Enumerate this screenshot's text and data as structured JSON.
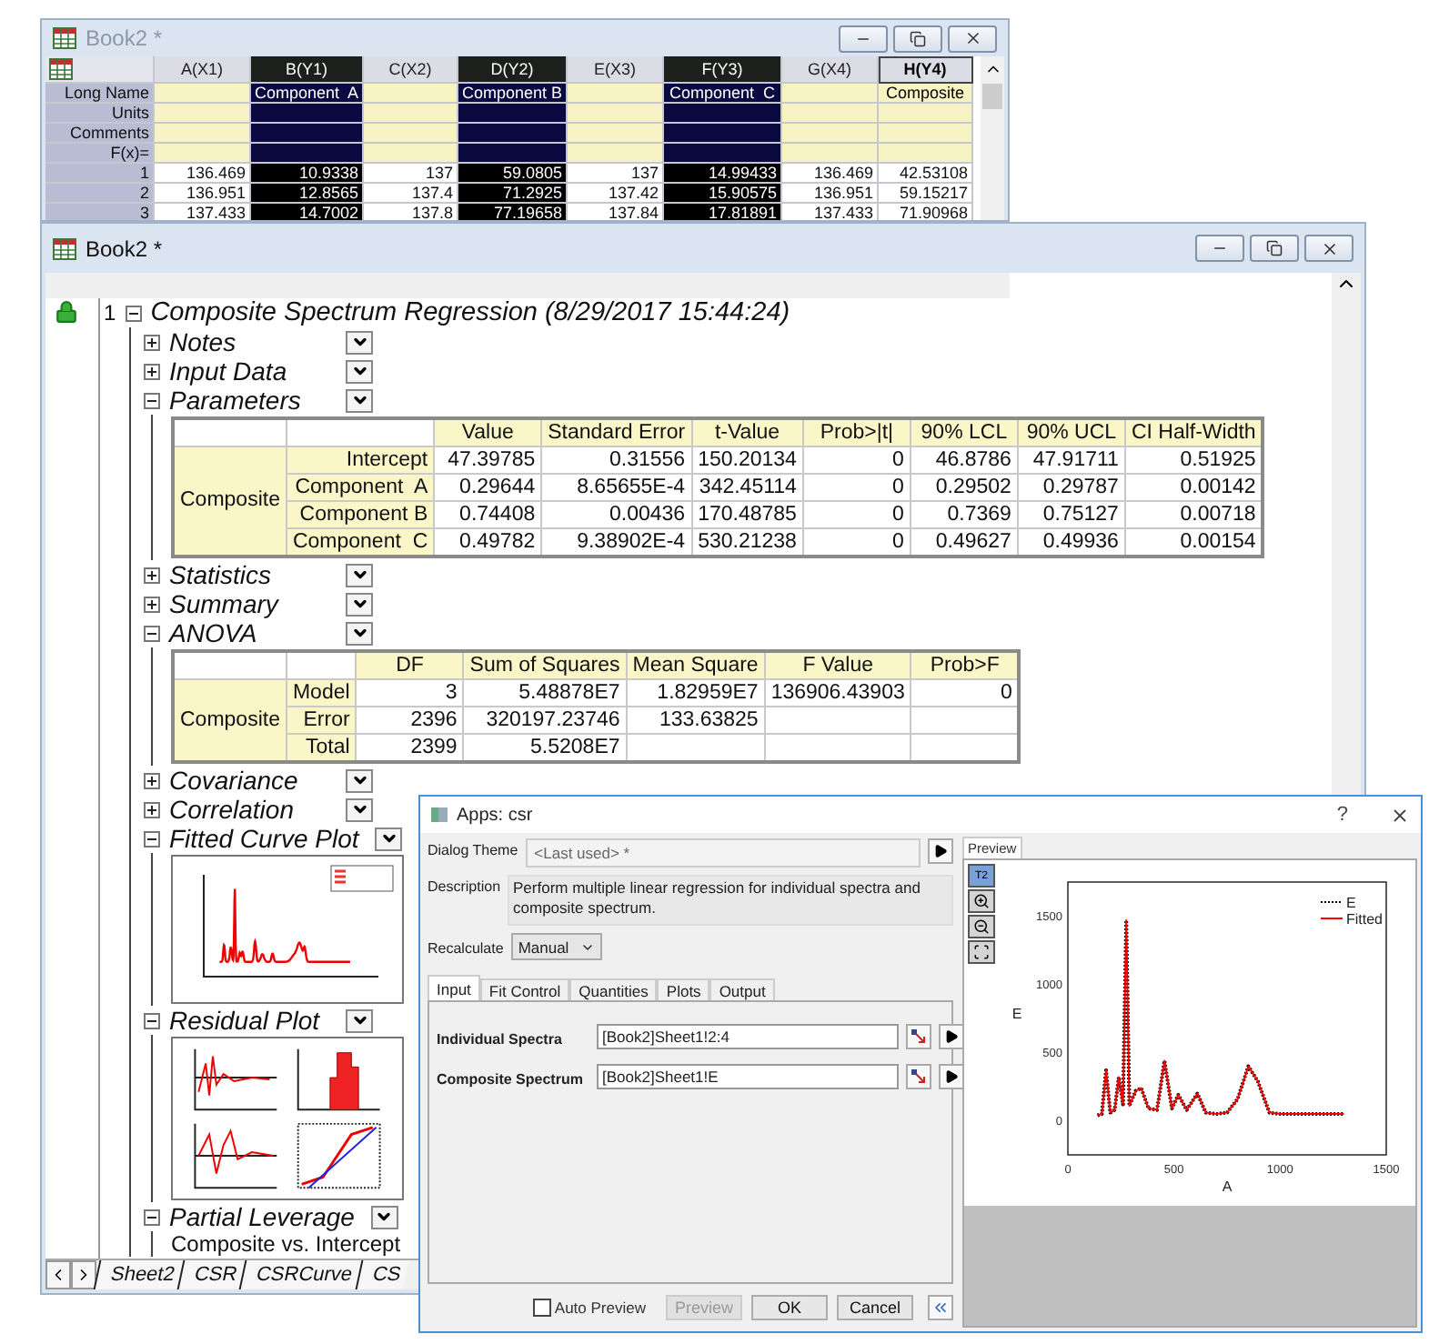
{
  "back_window": {
    "title": "Book2 *",
    "columns": [
      {
        "label": "A(X1)",
        "selected": false,
        "active": false
      },
      {
        "label": "B(Y1)",
        "selected": true,
        "active": false,
        "long_name": "Component  A"
      },
      {
        "label": "C(X2)",
        "selected": false,
        "active": false
      },
      {
        "label": "D(Y2)",
        "selected": true,
        "active": false,
        "long_name": "Component B"
      },
      {
        "label": "E(X3)",
        "selected": false,
        "active": false
      },
      {
        "label": "F(Y3)",
        "selected": true,
        "active": false,
        "long_name": "Component  C"
      },
      {
        "label": "G(X4)",
        "selected": false,
        "active": false
      },
      {
        "label": "H(Y4)",
        "selected": false,
        "active": true,
        "long_name": "Composite"
      }
    ],
    "label_rows": [
      "Long Name",
      "Units",
      "Comments",
      "F(x)="
    ],
    "rows": [
      {
        "index": "1",
        "cells": [
          "136.469",
          "10.9338",
          "137",
          "59.0805",
          "137",
          "14.99433",
          "136.469",
          "42.53108"
        ]
      },
      {
        "index": "2",
        "cells": [
          "136.951",
          "12.8565",
          "137.4",
          "71.2925",
          "137.42",
          "15.90575",
          "136.951",
          "59.15217"
        ]
      },
      {
        "index": "3",
        "cells": [
          "137.433",
          "14.7002",
          "137.8",
          "77.19658",
          "137.84",
          "17.81891",
          "137.433",
          "71.90968"
        ]
      }
    ]
  },
  "main_window": {
    "title": "Book2 *",
    "report": {
      "index": "1",
      "title": "Composite Spectrum Regression (8/29/2017 15:44:24)",
      "expanded": true,
      "sections": [
        {
          "label": "Notes",
          "expanded": false
        },
        {
          "label": "Input Data",
          "expanded": false
        },
        {
          "label": "Parameters",
          "expanded": true,
          "content": {
            "kind": "table",
            "group": "Composite",
            "columns": [
              "Value",
              "Standard Error",
              "t-Value",
              "Prob>|t|",
              "90% LCL",
              "90% UCL",
              "CI Half-Width"
            ],
            "rows": [
              {
                "label": "Intercept",
                "cells": [
                  "47.39785",
                  "0.31556",
                  "150.20134",
                  "0",
                  "46.8786",
                  "47.91711",
                  "0.51925"
                ]
              },
              {
                "label": "Component  A",
                "cells": [
                  "0.29644",
                  "8.65655E-4",
                  "342.45114",
                  "0",
                  "0.29502",
                  "0.29787",
                  "0.00142"
                ]
              },
              {
                "label": "Component B",
                "cells": [
                  "0.74408",
                  "0.00436",
                  "170.48785",
                  "0",
                  "0.7369",
                  "0.75127",
                  "0.00718"
                ]
              },
              {
                "label": "Component  C",
                "cells": [
                  "0.49782",
                  "9.38902E-4",
                  "530.21238",
                  "0",
                  "0.49627",
                  "0.49936",
                  "0.00154"
                ]
              }
            ]
          }
        },
        {
          "label": "Statistics",
          "expanded": false
        },
        {
          "label": "Summary",
          "expanded": false
        },
        {
          "label": "ANOVA",
          "expanded": true,
          "content": {
            "kind": "table",
            "group": "Composite",
            "columns": [
              "DF",
              "Sum of Squares",
              "Mean Square",
              "F Value",
              "Prob>F"
            ],
            "rows": [
              {
                "label": "Model",
                "cells": [
                  "3",
                  "5.48878E7",
                  "1.82959E7",
                  "136906.43903",
                  "0"
                ]
              },
              {
                "label": "Error",
                "cells": [
                  "2396",
                  "320197.23746",
                  "133.63825",
                  null,
                  null
                ]
              },
              {
                "label": "Total",
                "cells": [
                  "2399",
                  "5.5208E7",
                  null,
                  null,
                  null
                ]
              }
            ]
          }
        },
        {
          "label": "Covariance",
          "expanded": false
        },
        {
          "label": "Correlation",
          "expanded": false
        },
        {
          "label": "Fitted Curve Plot",
          "expanded": true,
          "content": {
            "kind": "fitted_plot"
          }
        },
        {
          "label": "Residual Plot",
          "expanded": true,
          "content": {
            "kind": "residual_plots"
          }
        },
        {
          "label": "Partial Leverage",
          "expanded": true,
          "content": {
            "kind": "caption",
            "text": "Composite vs. Intercept"
          }
        }
      ]
    },
    "sheet_tabs": [
      "Sheet2",
      "CSR",
      "CSRCurve",
      "CS"
    ]
  },
  "dialog": {
    "title": "Apps: csr",
    "help": "?",
    "theme": {
      "label": "Dialog Theme",
      "value": "<Last used> *"
    },
    "description": {
      "label": "Description",
      "text": "Perform multiple linear regression for individual spectra and composite spectrum."
    },
    "recalculate": {
      "label": "Recalculate",
      "value": "Manual"
    },
    "tabs": [
      {
        "label": "Input",
        "selected": true
      },
      {
        "label": "Fit Control",
        "selected": false
      },
      {
        "label": "Quantities",
        "selected": false
      },
      {
        "label": "Plots",
        "selected": false
      },
      {
        "label": "Output",
        "selected": false
      }
    ],
    "inputs": [
      {
        "label": "Individual Spectra",
        "value": "[Book2]Sheet1!2:4"
      },
      {
        "label": "Composite Spectrum",
        "value": "[Book2]Sheet1!E"
      }
    ],
    "auto_preview": {
      "label": "Auto Preview",
      "checked": false
    },
    "buttons": [
      {
        "label": "Preview",
        "disabled": true
      },
      {
        "label": "OK",
        "disabled": false
      },
      {
        "label": "Cancel",
        "disabled": false
      }
    ],
    "preview": {
      "tab": "Preview",
      "toolbar_label": "T2",
      "chart_data": {
        "type": "line",
        "xlabel": "A",
        "ylabel": "E",
        "xlim": [
          0,
          1500
        ],
        "ylim": [
          -250,
          1750
        ],
        "xticks": [
          0,
          500,
          1000,
          1500
        ],
        "yticks": [
          1500,
          1000,
          500,
          0
        ],
        "x": [
          140,
          160,
          180,
          200,
          220,
          240,
          260,
          275,
          290,
          320,
          345,
          380,
          420,
          455,
          490,
          520,
          560,
          610,
          650,
          700,
          750,
          800,
          850,
          895,
          950,
          1000,
          1100,
          1200,
          1300
        ],
        "legend": true,
        "series": [
          {
            "name": "E",
            "color": "#000000",
            "line_style": "dotted",
            "values": [
              40,
              50,
              370,
              60,
              80,
              320,
              120,
              1470,
              110,
              220,
              240,
              90,
              80,
              440,
              90,
              190,
              80,
              200,
              60,
              50,
              60,
              160,
              400,
              290,
              60,
              50,
              50,
              50,
              50
            ]
          },
          {
            "name": "Fitted",
            "color": "#ff0000",
            "values": [
              40,
              50,
              370,
              60,
              80,
              320,
              120,
              1470,
              110,
              220,
              240,
              90,
              80,
              440,
              90,
              190,
              80,
              200,
              60,
              50,
              60,
              160,
              400,
              290,
              60,
              50,
              50,
              50,
              50
            ]
          }
        ]
      }
    }
  }
}
